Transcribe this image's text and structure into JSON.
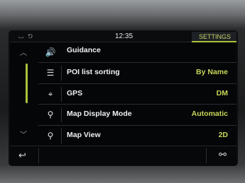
{
  "status": {
    "time": "12:35",
    "tab_label": "SETTINGS",
    "left_icons": "⌴ ⅁"
  },
  "rows": [
    {
      "icon": "speaker-icon",
      "glyph": "🔊",
      "label": "Guidance",
      "value": ""
    },
    {
      "icon": "list-icon",
      "glyph": "☰",
      "label": "POI list sorting",
      "value": "By Name"
    },
    {
      "icon": "gps-icon",
      "glyph": "⌖",
      "label": "GPS",
      "value": "DM"
    },
    {
      "icon": "map-mode-icon",
      "glyph": "⚲",
      "label": "Map Display Mode",
      "value": "Automatic"
    },
    {
      "icon": "map-view-icon",
      "glyph": "⚲",
      "label": "Map View",
      "value": "2D"
    }
  ],
  "nav": {
    "up": "︿",
    "down": "﹀",
    "back": "↩",
    "link": "⚯"
  },
  "colors": {
    "accent": "#a8c43a",
    "value_text": "#c8d65a",
    "label_text": "#eef0f1"
  }
}
